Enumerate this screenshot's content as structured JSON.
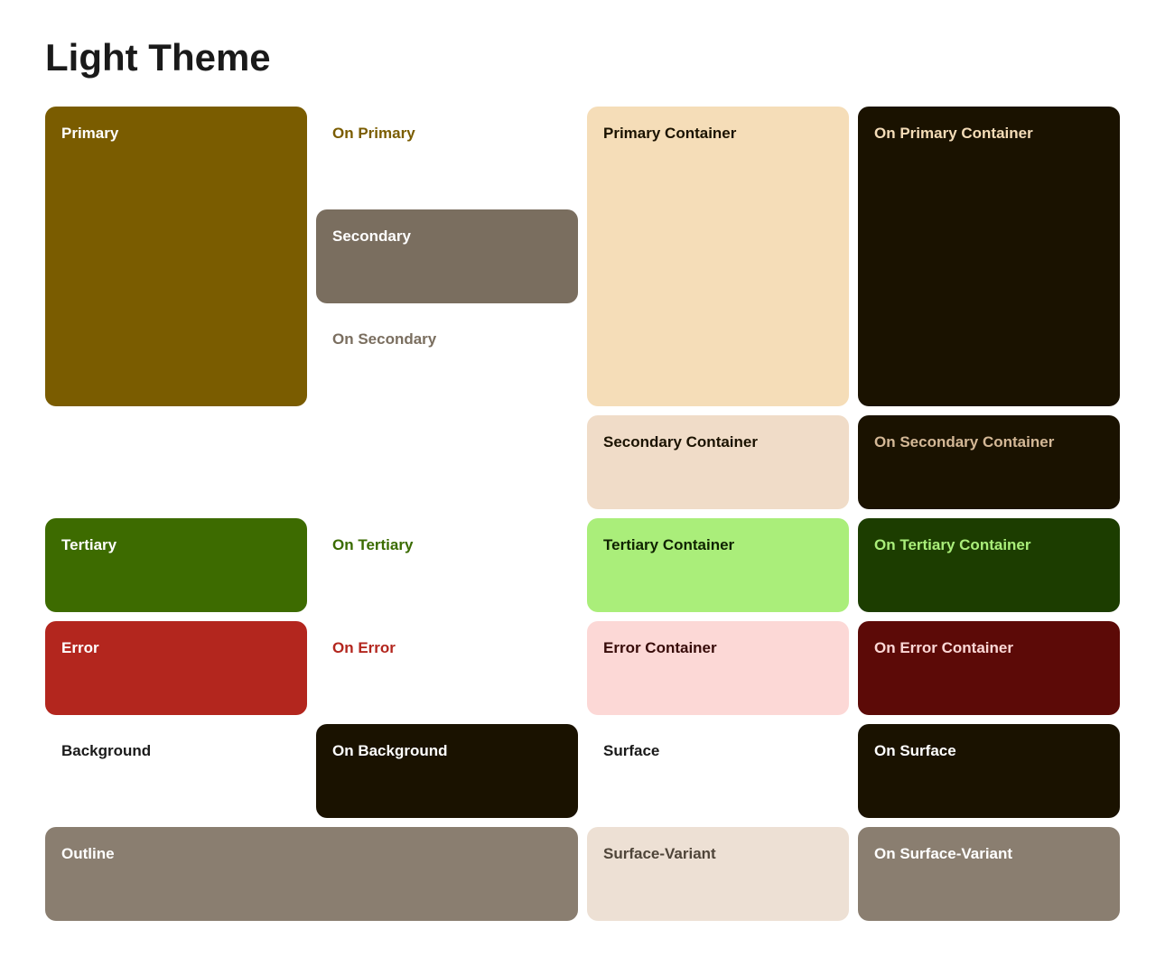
{
  "title": "Light Theme",
  "rows": [
    {
      "cells": [
        {
          "id": "primary",
          "label": "Primary",
          "bg": "#7a5c00",
          "color": "#ffffff",
          "rowSpan": 3,
          "colSpan": 1,
          "radius": "12px"
        },
        {
          "id": "on-primary",
          "label": "On Primary",
          "bg": "transparent",
          "color": "#7a5c00",
          "rowSpan": 1,
          "colSpan": 1
        },
        {
          "id": "primary-container",
          "label": "Primary Container",
          "bg": "#f5ddb8",
          "color": "#1a1200",
          "rowSpan": 3,
          "colSpan": 1
        },
        {
          "id": "on-primary-container",
          "label": "On Primary Container",
          "bg": "#1a1200",
          "color": "#f5ddb8",
          "rowSpan": 3,
          "colSpan": 1
        }
      ]
    },
    {
      "cells": [
        {
          "id": "on-secondary",
          "label": "On Secondary",
          "bg": "transparent",
          "color": "#7a6e5f",
          "rowSpan": 1,
          "colSpan": 1
        }
      ]
    },
    {
      "cells": [
        {
          "id": "on-tertiary",
          "label": "On Tertiary",
          "bg": "transparent",
          "color": "#3a6b00",
          "rowSpan": 1,
          "colSpan": 1
        }
      ]
    }
  ],
  "colors": {
    "primary": {
      "label": "Primary",
      "bg": "#7a5c00",
      "color": "#ffffff"
    },
    "on-primary": {
      "label": "On Primary",
      "bg": "transparent",
      "color": "#7a5c00"
    },
    "primary-container": {
      "label": "Primary Container",
      "bg": "#f5ddb8",
      "color": "#1a1200"
    },
    "on-primary-container": {
      "label": "On Primary Container",
      "bg": "#1a1200",
      "color": "#f5ddb8"
    },
    "secondary": {
      "label": "Secondary",
      "bg": "#7a6e5f",
      "color": "#ffffff"
    },
    "on-secondary": {
      "label": "On Secondary",
      "bg": "transparent",
      "color": "#7a6e5f"
    },
    "secondary-container": {
      "label": "Secondary Container",
      "bg": "#f0dcc8",
      "color": "#1a1200"
    },
    "on-secondary-container": {
      "label": "On Secondary Container",
      "bg": "#1a1200",
      "color": "#d4b896"
    },
    "tertiary": {
      "label": "Tertiary",
      "bg": "#3d6b00",
      "color": "#ffffff"
    },
    "on-tertiary": {
      "label": "On Tertiary",
      "bg": "transparent",
      "color": "#3a6b00"
    },
    "tertiary-container": {
      "label": "Tertiary Container",
      "bg": "#aaee7a",
      "color": "#0f2300"
    },
    "on-tertiary-container": {
      "label": "On Tertiary Container",
      "bg": "#0f2300",
      "color": "#aaee7a"
    },
    "error": {
      "label": "Error",
      "bg": "#b3261e",
      "color": "#ffffff"
    },
    "on-error": {
      "label": "On Error",
      "bg": "transparent",
      "color": "#b3261e"
    },
    "error-container": {
      "label": "Error Container",
      "bg": "#fcd8d6",
      "color": "#370b09"
    },
    "on-error-container": {
      "label": "On Error Container",
      "bg": "#5c0a07",
      "color": "#fcd8d6"
    },
    "background": {
      "label": "Background",
      "bg": "transparent",
      "color": "#1a1a1a"
    },
    "on-background": {
      "label": "On Background",
      "bg": "#1a1200",
      "color": "#ffffff"
    },
    "surface": {
      "label": "Surface",
      "bg": "transparent",
      "color": "#1a1a1a"
    },
    "on-surface": {
      "label": "On Surface",
      "bg": "#1a1200",
      "color": "#ffffff"
    },
    "outline": {
      "label": "Outline",
      "bg": "#8a7e70",
      "color": "#ffffff"
    },
    "surface-variant": {
      "label": "Surface-Variant",
      "bg": "#ede0d4",
      "color": "#4f4539"
    },
    "on-surface-variant": {
      "label": "On Surface-Variant",
      "bg": "#8a7e70",
      "color": "#ffffff"
    }
  }
}
